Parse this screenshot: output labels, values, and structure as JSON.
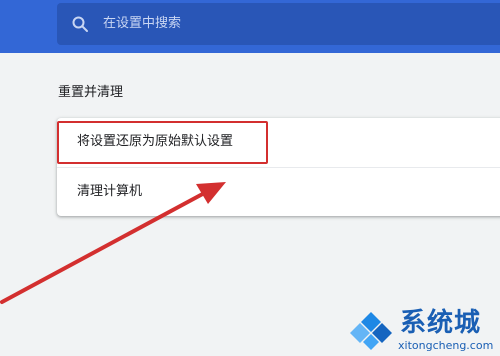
{
  "search": {
    "placeholder": "在设置中搜索"
  },
  "reset_section": {
    "title": "重置并清理",
    "items": [
      {
        "label": "将设置还原为原始默认设置"
      },
      {
        "label": "清理计算机"
      }
    ]
  },
  "watermark": {
    "brand": "系统城",
    "url": "xitongcheng.com"
  },
  "colors": {
    "header": "#3367d6",
    "annotation": "#d32f2f"
  }
}
